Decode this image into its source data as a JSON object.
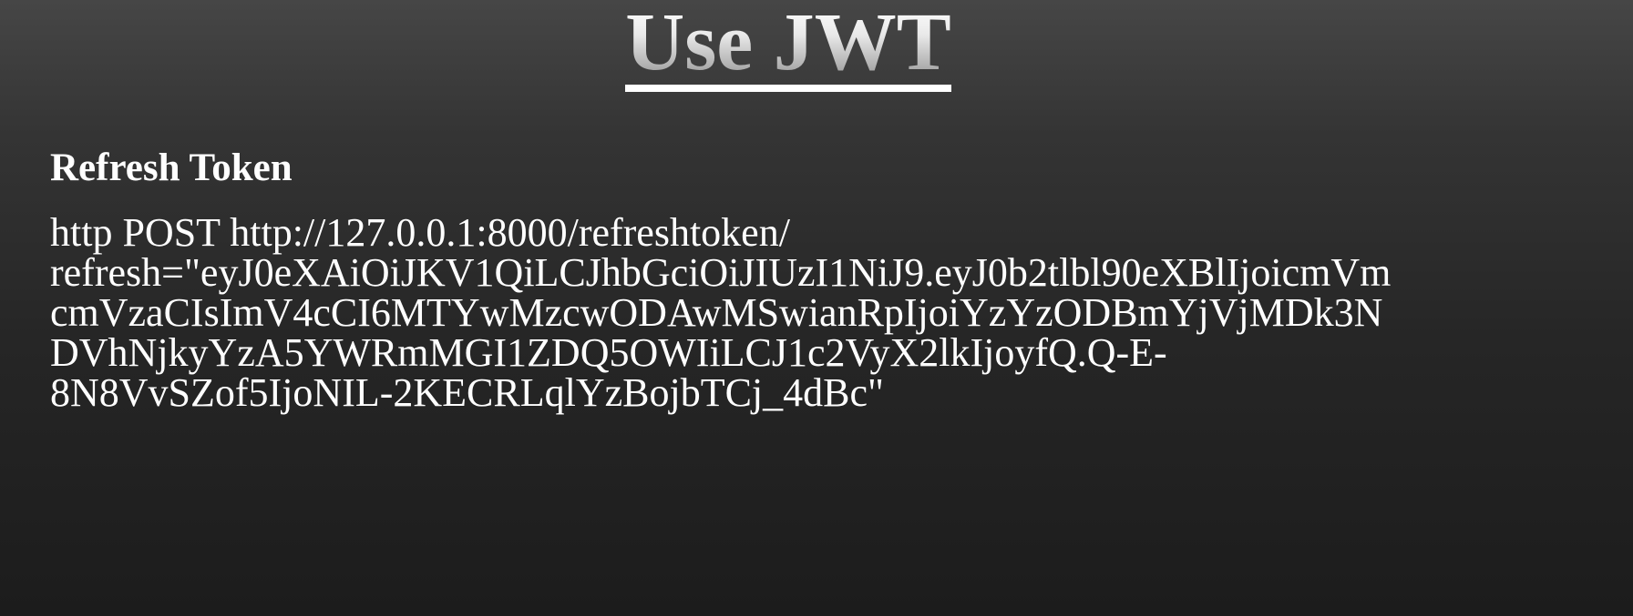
{
  "slide": {
    "title": "Use JWT",
    "section_heading": "Refresh Token",
    "command_lines": [
      "http POST http://127.0.0.1:8000/refreshtoken/",
      "refresh=\"eyJ0eXAiOiJKV1QiLCJhbGciOiJIUzI1NiJ9.eyJ0b2tlbl90eXBlIjoicmVm",
      "cmVzaCIsImV4cCI6MTYwMzcwODAwMSwianRpIjoiYzYzODBmYjVjMDk3N",
      "DVhNjkyYzA5YWRmMGI1ZDQ5OWIiLCJ1c2VyX2lkIjoyfQ.Q-E-",
      "8N8VvSZof5IjoNIL-2KECRLqlYzBojbTCj_4dBc\""
    ]
  },
  "colors": {
    "background_top": "#464646",
    "background_bottom": "#1c1c1c",
    "text": "#ffffff"
  }
}
